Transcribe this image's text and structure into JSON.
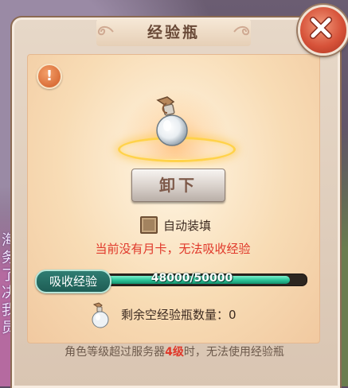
{
  "dialog": {
    "title": "经验瓶",
    "unload_button": "卸下",
    "auto_equip_label": "自动装填",
    "auto_equip_checked": true,
    "warning": "当前没有月卡，无法吸收经验",
    "absorb_label": "吸收经验",
    "progress": {
      "text": "48000/50000",
      "current": 48000,
      "max": 50000
    },
    "remaining_label": "剩余空经验瓶数量：",
    "remaining_count": "0",
    "footer": {
      "prefix": "角色等级超过服务器",
      "level": "4级",
      "suffix": "时，无法使用经验瓶"
    }
  },
  "background_text": [
    "海",
    "务",
    "了",
    "决",
    "我",
    "员"
  ],
  "icons": {
    "close": "close-x-icon",
    "info": "exclamation-icon",
    "item": "experience-bottle-icon"
  },
  "colors": {
    "warning": "#e0382a",
    "progress_fill": "#2fc79c",
    "close_button": "#d7533a"
  }
}
